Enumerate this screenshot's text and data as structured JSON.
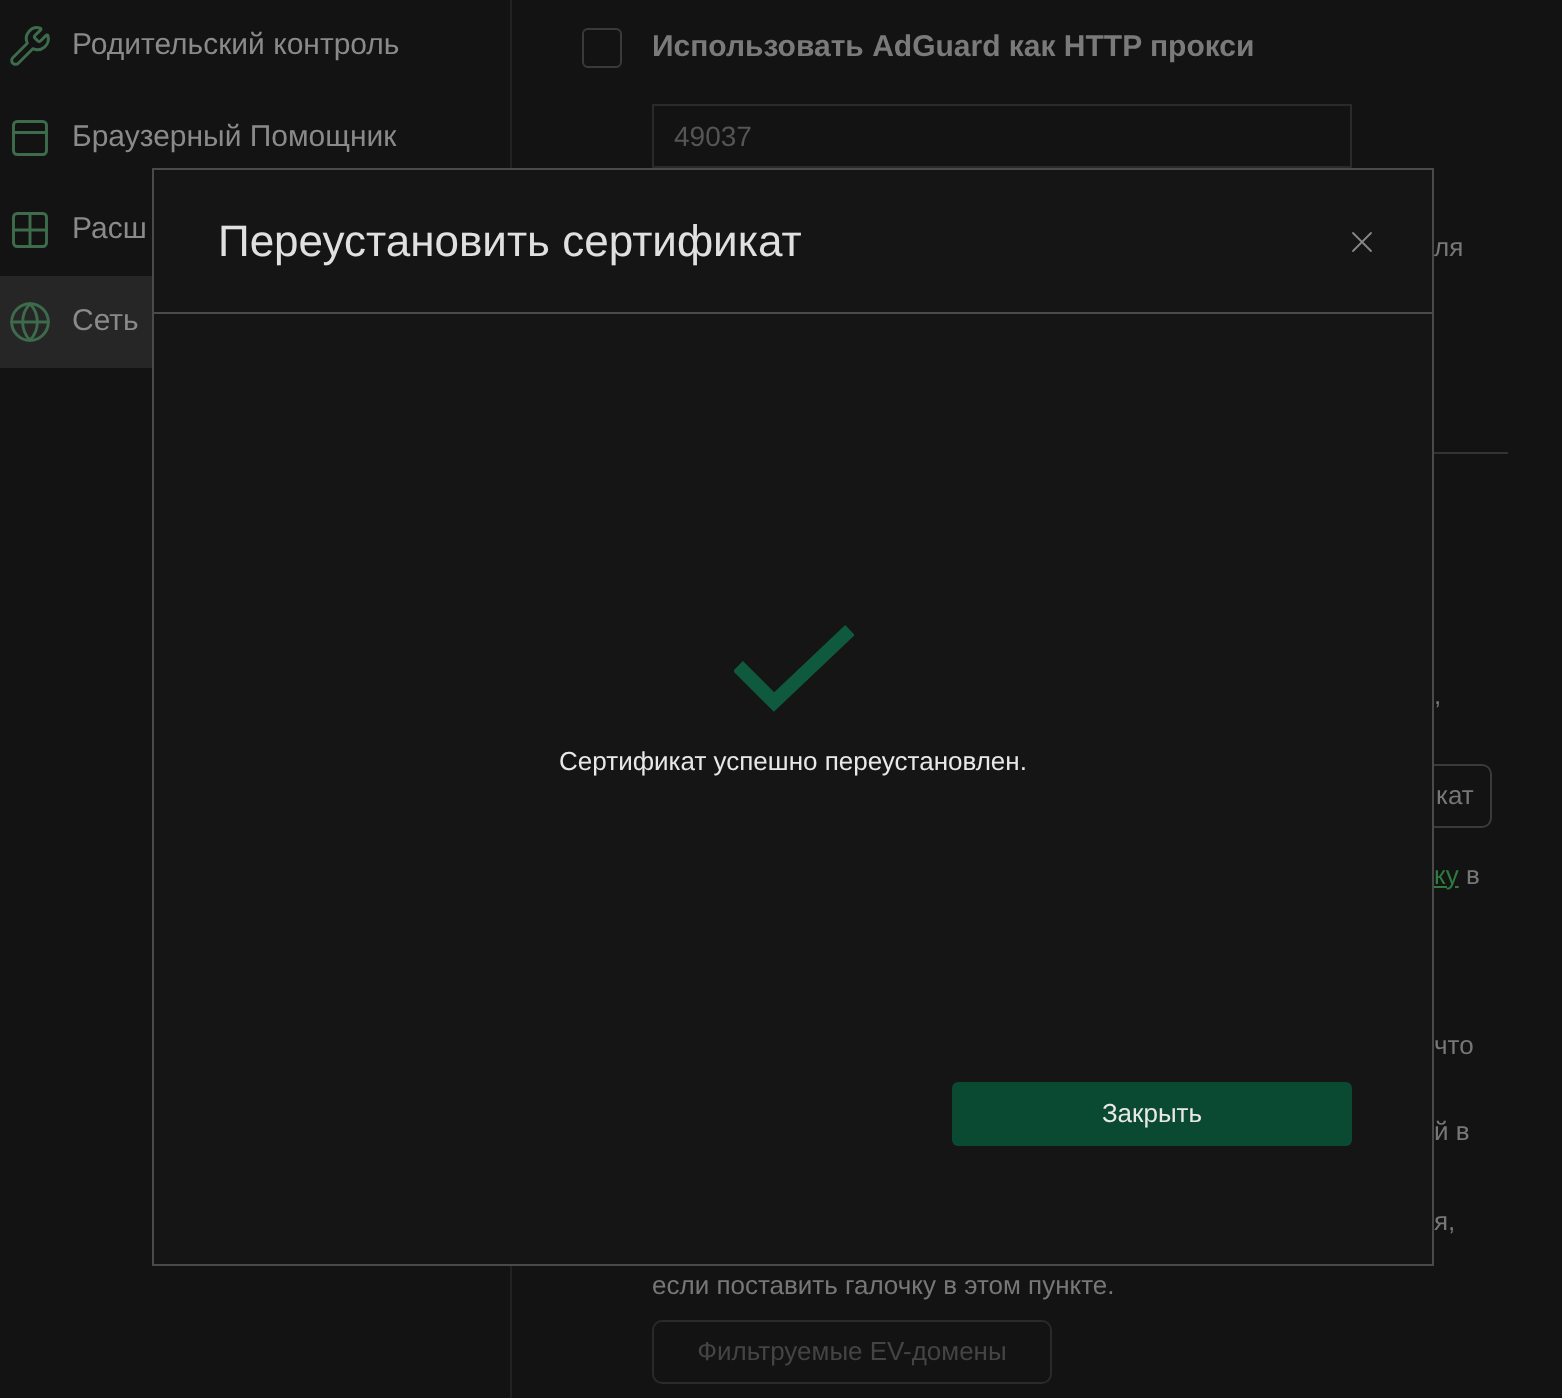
{
  "sidebar": {
    "items": [
      {
        "label": "Родительский контроль",
        "selected": false
      },
      {
        "label": "Браузерный Помощник",
        "selected": false
      },
      {
        "label": "Расш",
        "selected": false
      },
      {
        "label": "Сеть",
        "selected": true
      }
    ]
  },
  "main": {
    "proxy": {
      "label": "Использовать AdGuard как HTTP прокси",
      "checked": false,
      "port": "49037"
    },
    "fragments": [
      {
        "kind": "text",
        "text": "ля"
      },
      {
        "kind": "text",
        "text": ","
      },
      {
        "kind": "button",
        "text": "кат"
      },
      {
        "kind": "link",
        "text": "ку",
        "after": " в"
      },
      {
        "kind": "text",
        "text": "что"
      },
      {
        "kind": "text",
        "text": "й в"
      },
      {
        "kind": "text",
        "text": "я,"
      }
    ],
    "note": "если поставить галочку в этом пункте.",
    "ev_button": {
      "label": "Фильтруемые EV-домены",
      "disabled": true
    }
  },
  "dialog": {
    "title": "Переустановить сертификат",
    "message": "Сертификат успешно переустановлен.",
    "button": "Закрыть"
  }
}
